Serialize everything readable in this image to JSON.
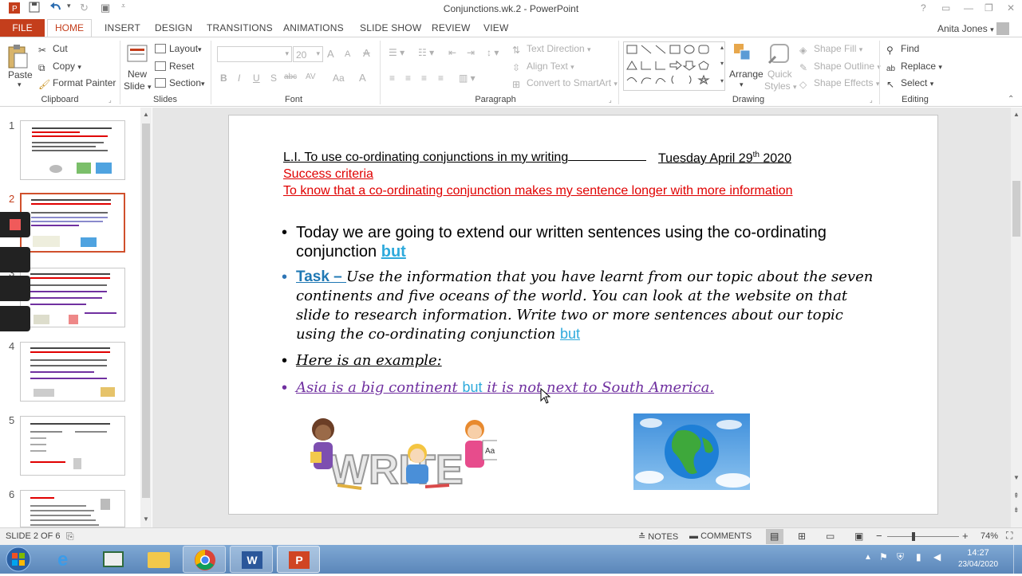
{
  "window": {
    "title": "Conjunctions.wk.2 - PowerPoint",
    "help": "?",
    "user": "Anita Jones"
  },
  "tabs": [
    "FILE",
    "HOME",
    "INSERT",
    "DESIGN",
    "TRANSITIONS",
    "ANIMATIONS",
    "SLIDE SHOW",
    "REVIEW",
    "VIEW"
  ],
  "ribbon": {
    "clipboard": {
      "paste": "Paste",
      "cut": "Cut",
      "copy": "Copy",
      "format_painter": "Format Painter",
      "group": "Clipboard"
    },
    "slides": {
      "new_slide_1": "New",
      "new_slide_2": "Slide",
      "layout": "Layout",
      "reset": "Reset",
      "section": "Section",
      "group": "Slides"
    },
    "font": {
      "size": "20",
      "bold": "B",
      "italic": "I",
      "underline": "U",
      "shadow": "S",
      "strike": "abc",
      "spacing": "AV",
      "case": "Aa",
      "color": "A",
      "grow": "A",
      "shrink": "A",
      "group": "Font"
    },
    "paragraph": {
      "text_direction": "Text Direction",
      "align_text": "Align Text",
      "convert": "Convert to SmartArt",
      "group": "Paragraph"
    },
    "drawing": {
      "arrange": "Arrange",
      "quick_styles_1": "Quick",
      "quick_styles_2": "Styles",
      "shape_fill": "Shape Fill",
      "shape_outline": "Shape Outline",
      "shape_effects": "Shape Effects",
      "group": "Drawing"
    },
    "editing": {
      "find": "Find",
      "replace": "Replace",
      "select": "Select",
      "group": "Editing"
    }
  },
  "thumbnails": [
    "1",
    "2",
    "3",
    "4",
    "5",
    "6"
  ],
  "slide": {
    "li": "L.I. To use co-ordinating conjunctions in my writing",
    "date_pre": "Tuesday April 29",
    "date_sup": "th",
    "date_post": " 2020",
    "success": "Success criteria",
    "criteria": "To know that a co-ordinating conjunction makes my sentence longer with more information",
    "bullet1_a": "Today we are going to extend our written sentences using the co-ordinating",
    "bullet1_b": "conjunction ",
    "bullet1_but": "but",
    "task_label": "Task – ",
    "task_1": "Use the information that you have learnt from our topic about the seven",
    "task_2": "continents and five oceans of the world. You can look at the website on that",
    "task_3": "slide to research information.   Write two or more sentences about our topic",
    "task_4": "using the co-ordinating conjunction ",
    "task_but": "but",
    "example": "Here is an example:",
    "ex_a": "Asia is a big continent ",
    "ex_but": "but",
    "ex_b": "  it is not next to South America.",
    "write_img": "WRITE",
    "write_aa": "Aa"
  },
  "status": {
    "slide": "SLIDE 2 OF 6",
    "notes": "NOTES",
    "comments": "COMMENTS",
    "zoom": "74%"
  },
  "clock": {
    "time": "14:27",
    "date": "23/04/2020"
  },
  "colors": {
    "accent": "#c43e1c",
    "red_text": "#e00000",
    "blue_but": "#2eaadc",
    "purple": "#7030a0"
  }
}
